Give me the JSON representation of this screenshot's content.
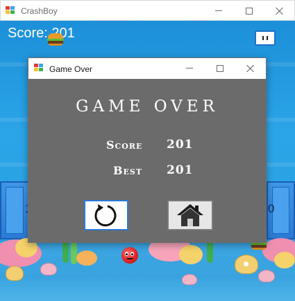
{
  "main_window": {
    "title": "CrashBoy"
  },
  "game": {
    "score_text": "Score: 201",
    "side_left_digit": "1",
    "side_right_digit": "0"
  },
  "dialog": {
    "title": "Game Over",
    "heading": "GAME OVER",
    "score_label": "Score",
    "score_value": "201",
    "best_label": "Best",
    "best_value": "201"
  },
  "icons": {
    "restart": "restart-icon",
    "home": "home-icon",
    "pause": "pause-icon"
  },
  "colors": {
    "dialog_bg": "#6b6b6b",
    "water": "#2ba5e8",
    "accent_border": "#2a7ad6"
  }
}
